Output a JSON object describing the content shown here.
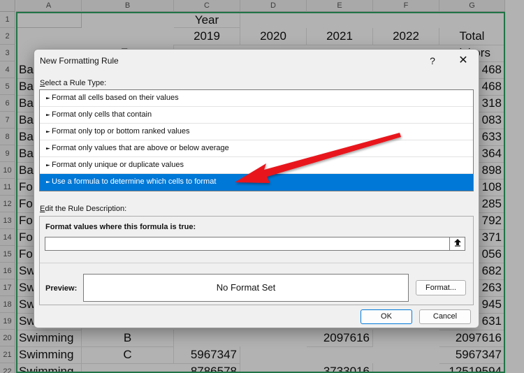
{
  "sheet": {
    "columns": [
      "A",
      "B",
      "C",
      "D",
      "E",
      "F",
      "G"
    ],
    "rows": [
      "1",
      "2",
      "3",
      "4",
      "5",
      "6",
      "7",
      "8",
      "9",
      "10",
      "11",
      "12",
      "13",
      "14",
      "15",
      "16",
      "17",
      "18",
      "19",
      "20",
      "21",
      "22"
    ],
    "header": {
      "year": "Year",
      "y2019": "2019",
      "y2020": "2020",
      "y2021": "2021",
      "y2022": "2022",
      "total": "Total",
      "row3_b": "Fa",
      "row3_g": "visitors"
    },
    "visible_a": [
      "Ba",
      "Ba",
      "Ba",
      "Ba",
      "Ba",
      "Ba",
      "Ba",
      "Fo",
      "Fo",
      "Fo",
      "Fo",
      "Fo",
      "Sw",
      "Sw",
      "Sw",
      "Swimming",
      "Swimming",
      "Swimming",
      "Swimming"
    ],
    "visible_g": [
      "468",
      "468",
      "318",
      "083",
      "633",
      "364",
      "898",
      "108",
      "285",
      "792",
      "371",
      "056",
      "682",
      "263",
      "945",
      "631"
    ],
    "row20": {
      "a": "Swimming",
      "b": "B",
      "e": "2097616",
      "g": "2097616"
    },
    "row21": {
      "a": "Swimming",
      "b": "C",
      "c": "5967347",
      "g": "5967347"
    },
    "row22": {
      "a": "Swimming",
      "c": "8786578",
      "e": "3733016",
      "g": "12519594"
    }
  },
  "dialog": {
    "title": "New Formatting Rule",
    "help_glyph": "?",
    "close_glyph": "✕",
    "select_rule_label_prefix": "S",
    "select_rule_label": "elect a Rule Type:",
    "rule_types": [
      "Format all cells based on their values",
      "Format only cells that contain",
      "Format only top or bottom ranked values",
      "Format only values that are above or below average",
      "Format only unique or duplicate values",
      "Use a formula to determine which cells to format"
    ],
    "selected_rule_index": 5,
    "edit_desc_label_prefix": "E",
    "edit_desc_label": "dit the Rule Description:",
    "formula_caption": "Format values where this formula is true:",
    "formula_value": "",
    "preview_label": "Preview:",
    "preview_text": "No Format Set",
    "format_button": "Format...",
    "ok_button": "OK",
    "cancel_button": "Cancel"
  },
  "colors": {
    "selection_blue": "#0078d7",
    "annotation_red": "#e8141c",
    "sheet_selection_green": "#217346"
  }
}
